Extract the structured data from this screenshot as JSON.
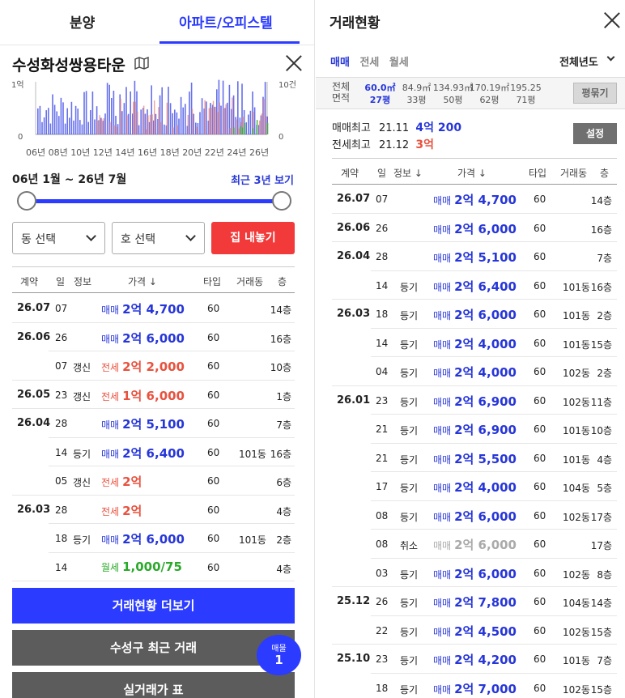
{
  "nav": {
    "tab1": "분양",
    "tab2": "아파트/오피스텔"
  },
  "complex": {
    "name": "수성화성쌍용타운"
  },
  "chart": {
    "left_axis_top": "1억",
    "left_axis_zero": "0",
    "right_axis_top": "10건",
    "right_axis_zero": "0",
    "x_ticks": [
      "06년",
      "08년",
      "10년",
      "12년",
      "14년",
      "16년",
      "18년",
      "20년",
      "22년",
      "24년",
      "26년"
    ]
  },
  "range": {
    "label": "06년 1월 ~ 26년 7월",
    "recent": "최근 3년 보기"
  },
  "filters": {
    "dong": "동 선택",
    "ho": "호 선택",
    "list_home": "집 내놓기"
  },
  "left_table": {
    "headers": {
      "contract": "계약",
      "day": "일",
      "info": "정보",
      "price": "가격 ↓",
      "type": "타입",
      "bldg": "거래동",
      "floor": "층"
    },
    "rows": [
      {
        "ym": "26.07",
        "d": "07",
        "info": "",
        "t": "매매",
        "p": "2억 4,700",
        "k": "sale",
        "tp": "60",
        "b": "",
        "f": "14층"
      },
      {
        "ym": "26.06",
        "d": "26",
        "info": "",
        "t": "매매",
        "p": "2억 6,000",
        "k": "sale",
        "tp": "60",
        "b": "",
        "f": "16층"
      },
      {
        "ym": "",
        "d": "07",
        "info": "갱신",
        "t": "전세",
        "p": "2억 2,000",
        "k": "jeonse",
        "tp": "60",
        "b": "",
        "f": "10층"
      },
      {
        "ym": "26.05",
        "d": "23",
        "info": "갱신",
        "t": "전세",
        "p": "1억 6,000",
        "k": "jeonse",
        "tp": "60",
        "b": "",
        "f": "1층"
      },
      {
        "ym": "26.04",
        "d": "28",
        "info": "",
        "t": "매매",
        "p": "2억 5,100",
        "k": "sale",
        "tp": "60",
        "b": "",
        "f": "7층"
      },
      {
        "ym": "",
        "d": "14",
        "info": "등기",
        "t": "매매",
        "p": "2억 6,400",
        "k": "sale",
        "tp": "60",
        "b": "101동",
        "f": "16층"
      },
      {
        "ym": "",
        "d": "05",
        "info": "갱신",
        "t": "전세",
        "p": "2억",
        "k": "jeonse",
        "tp": "60",
        "b": "",
        "f": "6층"
      },
      {
        "ym": "26.03",
        "d": "28",
        "info": "",
        "t": "전세",
        "p": "2억",
        "k": "jeonse",
        "tp": "60",
        "b": "",
        "f": "4층"
      },
      {
        "ym": "",
        "d": "18",
        "info": "등기",
        "t": "매매",
        "p": "2억 6,000",
        "k": "sale",
        "tp": "60",
        "b": "101동",
        "f": "2층"
      },
      {
        "ym": "",
        "d": "14",
        "info": "",
        "t": "월세",
        "p": "1,000/75",
        "k": "wolse",
        "tp": "60",
        "b": "",
        "f": "4층"
      }
    ]
  },
  "buttons": {
    "more": "거래현황 더보기",
    "recent_gu": "수성구 최근 거래",
    "real_price": "실거래가 표"
  },
  "badge": {
    "label": "매물",
    "count": "1"
  },
  "right": {
    "title": "거래현황",
    "tabs": [
      "매매",
      "전세",
      "월세"
    ],
    "year_select": "전체년도",
    "area_label1": "전체",
    "area_label2": "면적",
    "areas": [
      {
        "m2": "60.0㎡",
        "py": "27평"
      },
      {
        "m2": "84.9㎡",
        "py": "33평"
      },
      {
        "m2": "134.93㎡",
        "py": "50평"
      },
      {
        "m2": "170.19㎡",
        "py": "62평"
      },
      {
        "m2": "195.25",
        "py": "71평"
      }
    ],
    "pyeong_btn": "평묶기",
    "sale_max": {
      "label": "매매최고",
      "date": "21.11",
      "price": "4억 200"
    },
    "jeonse_max": {
      "label": "전세최고",
      "date": "21.12",
      "price": "3억"
    },
    "settings": "설정",
    "headers": {
      "contract": "계약",
      "day": "일",
      "info": "정보 ↓",
      "price": "가격 ↓",
      "type": "타입",
      "bldg": "거래동",
      "floor": "층"
    },
    "rows": [
      {
        "ym": "26.07",
        "d": "07",
        "info": "",
        "t": "매매",
        "p": "2억 4,700",
        "k": "sale",
        "tp": "60",
        "b": "",
        "f": "14층"
      },
      {
        "ym": "26.06",
        "d": "26",
        "info": "",
        "t": "매매",
        "p": "2억 6,000",
        "k": "sale",
        "tp": "60",
        "b": "",
        "f": "16층"
      },
      {
        "ym": "26.04",
        "d": "28",
        "info": "",
        "t": "매매",
        "p": "2억 5,100",
        "k": "sale",
        "tp": "60",
        "b": "",
        "f": "7층"
      },
      {
        "ym": "",
        "d": "14",
        "info": "등기",
        "t": "매매",
        "p": "2억 6,400",
        "k": "sale",
        "tp": "60",
        "b": "101동",
        "f": "16층"
      },
      {
        "ym": "26.03",
        "d": "18",
        "info": "등기",
        "t": "매매",
        "p": "2억 6,000",
        "k": "sale",
        "tp": "60",
        "b": "101동",
        "f": "2층"
      },
      {
        "ym": "",
        "d": "14",
        "info": "등기",
        "t": "매매",
        "p": "2억 4,000",
        "k": "sale",
        "tp": "60",
        "b": "101동",
        "f": "15층"
      },
      {
        "ym": "",
        "d": "04",
        "info": "등기",
        "t": "매매",
        "p": "2억 4,000",
        "k": "sale",
        "tp": "60",
        "b": "102동",
        "f": "2층"
      },
      {
        "ym": "26.01",
        "d": "23",
        "info": "등기",
        "t": "매매",
        "p": "2억 6,900",
        "k": "sale",
        "tp": "60",
        "b": "102동",
        "f": "11층"
      },
      {
        "ym": "",
        "d": "21",
        "info": "등기",
        "t": "매매",
        "p": "2억 6,900",
        "k": "sale",
        "tp": "60",
        "b": "101동",
        "f": "10층"
      },
      {
        "ym": "",
        "d": "21",
        "info": "등기",
        "t": "매매",
        "p": "2억 5,500",
        "k": "sale",
        "tp": "60",
        "b": "101동",
        "f": "4층"
      },
      {
        "ym": "",
        "d": "17",
        "info": "등기",
        "t": "매매",
        "p": "2억 4,000",
        "k": "sale",
        "tp": "60",
        "b": "104동",
        "f": "5층"
      },
      {
        "ym": "",
        "d": "08",
        "info": "등기",
        "t": "매매",
        "p": "2억 6,000",
        "k": "sale",
        "tp": "60",
        "b": "102동",
        "f": "17층"
      },
      {
        "ym": "",
        "d": "08",
        "info": "취소",
        "t": "매매",
        "p": "2억 6,000",
        "k": "cancel",
        "tp": "60",
        "b": "",
        "f": "17층"
      },
      {
        "ym": "",
        "d": "03",
        "info": "등기",
        "t": "매매",
        "p": "2억 6,000",
        "k": "sale",
        "tp": "60",
        "b": "102동",
        "f": "8층"
      },
      {
        "ym": "25.12",
        "d": "26",
        "info": "등기",
        "t": "매매",
        "p": "2억 7,800",
        "k": "sale",
        "tp": "60",
        "b": "104동",
        "f": "14층"
      },
      {
        "ym": "",
        "d": "22",
        "info": "등기",
        "t": "매매",
        "p": "2억 4,500",
        "k": "sale",
        "tp": "60",
        "b": "102동",
        "f": "15층"
      },
      {
        "ym": "25.10",
        "d": "23",
        "info": "등기",
        "t": "매매",
        "p": "2억 4,200",
        "k": "sale",
        "tp": "60",
        "b": "101동",
        "f": "7층"
      },
      {
        "ym": "",
        "d": "18",
        "info": "등기",
        "t": "매매",
        "p": "2억 7,000",
        "k": "sale",
        "tp": "60",
        "b": "102동",
        "f": "15층"
      }
    ]
  },
  "colors": {
    "accent": "#2b3bff",
    "sale": "#2736d9",
    "jeonse": "#e8523f",
    "wolse": "#2aa92a",
    "cta_red": "#f23a3a"
  }
}
